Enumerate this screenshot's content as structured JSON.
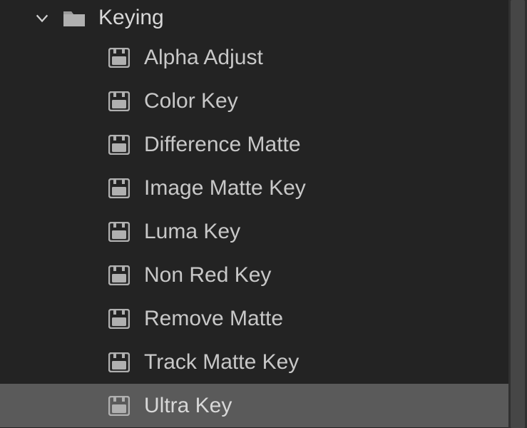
{
  "folder": {
    "label": "Keying",
    "expanded": true
  },
  "effects": [
    {
      "label": "Alpha Adjust",
      "selected": false
    },
    {
      "label": "Color Key",
      "selected": false
    },
    {
      "label": "Difference Matte",
      "selected": false
    },
    {
      "label": "Image Matte Key",
      "selected": false
    },
    {
      "label": "Luma Key",
      "selected": false
    },
    {
      "label": "Non Red Key",
      "selected": false
    },
    {
      "label": "Remove Matte",
      "selected": false
    },
    {
      "label": "Track Matte Key",
      "selected": false
    },
    {
      "label": "Ultra Key",
      "selected": true
    }
  ],
  "colors": {
    "bg": "#232323",
    "text": "#c8c8c8",
    "textBright": "#d8d8d8",
    "selected": "#5a5a5a",
    "scrollTrack": "#303030",
    "scrollThumb": "#464646"
  }
}
